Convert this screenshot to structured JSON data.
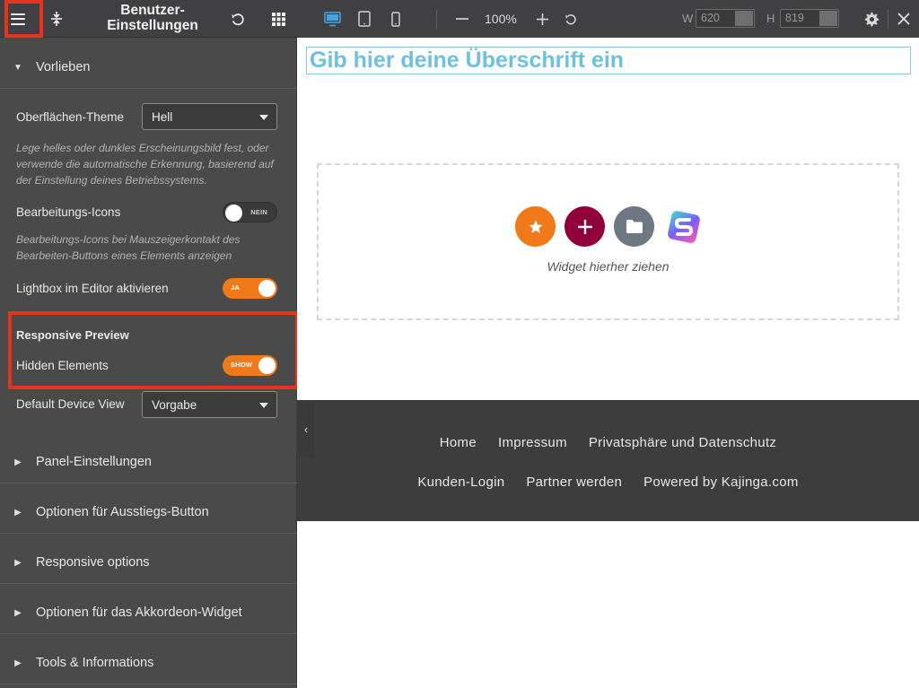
{
  "panel": {
    "title_line1": "Benutzer-",
    "title_line2": "Einstellungen",
    "preferences_label": "Vorlieben",
    "ui_theme": {
      "label": "Oberflächen-Theme",
      "value": "Hell",
      "description": "Lege helles oder dunkles Erscheinungsbild fest, oder verwende die automatische Erkennung, basierend auf der Einstellung deines Betriebssystems."
    },
    "edit_icons": {
      "label": "Bearbeitungs-Icons",
      "toggle_label": "NEIN",
      "description": "Bearbeitungs-Icons bei Mauszeigerkontakt des Bearbeiten-Buttons eines Elements anzeigen"
    },
    "lightbox": {
      "label": "Lightbox im Editor aktivieren",
      "toggle_label": "JA"
    },
    "responsive_preview": {
      "heading": "Responsive Preview",
      "hidden_elements_label": "Hidden Elements",
      "toggle_label": "SHOW"
    },
    "default_device": {
      "label": "Default Device View",
      "value": "Vorgabe"
    },
    "sections": [
      "Panel-Einstellungen",
      "Optionen für Ausstiegs-Button",
      "Responsive options",
      "Optionen für das Akkordeon-Widget",
      "Tools & Informations"
    ]
  },
  "toolbar": {
    "zoom": "100%",
    "width_label": "W",
    "width_value": "620",
    "height_label": "H",
    "height_value": "819"
  },
  "canvas": {
    "heading": "Gib hier deine Überschrift ein",
    "drop_text": "Widget hierher ziehen",
    "footer_row1": [
      "Home",
      "Impressum",
      "Privatsphäre und Datenschutz"
    ],
    "footer_row2": [
      "Kunden-Login",
      "Partner werden",
      "Powered by Kajinga.com"
    ]
  },
  "colors": {
    "panel_bg": "#4a4a4b",
    "toggle_on": "#f07a1a",
    "highlight": "#e8321c",
    "heading_text": "#6ec0e0",
    "add_circle": "#92003b",
    "star_circle": "#f07a1a"
  }
}
